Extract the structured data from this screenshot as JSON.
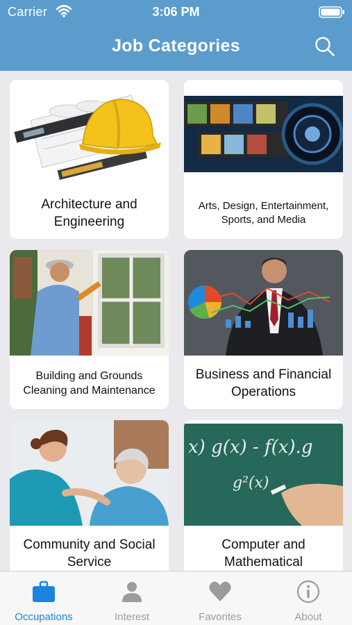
{
  "status": {
    "carrier": "Carrier",
    "time": "3:06 PM"
  },
  "nav": {
    "title": "Job Categories"
  },
  "categories": [
    {
      "label": "Architecture and Engineering"
    },
    {
      "label": "Arts, Design, Entertainment, Sports, and Media"
    },
    {
      "label": "Building and Grounds Cleaning and Maintenance"
    },
    {
      "label": "Business and Financial Operations"
    },
    {
      "label": "Community and Social Service"
    },
    {
      "label": "Computer and Mathematical"
    }
  ],
  "tabs": [
    {
      "label": "Occupations",
      "icon": "briefcase-icon",
      "active": true
    },
    {
      "label": "Interest",
      "icon": "person-icon",
      "active": false
    },
    {
      "label": "Favorites",
      "icon": "heart-icon",
      "active": false
    },
    {
      "label": "About",
      "icon": "info-icon",
      "active": false
    }
  ],
  "colors": {
    "accent": "#5b9ccd",
    "tab_active": "#1a84e0",
    "tab_inactive": "#9b9b9b"
  }
}
